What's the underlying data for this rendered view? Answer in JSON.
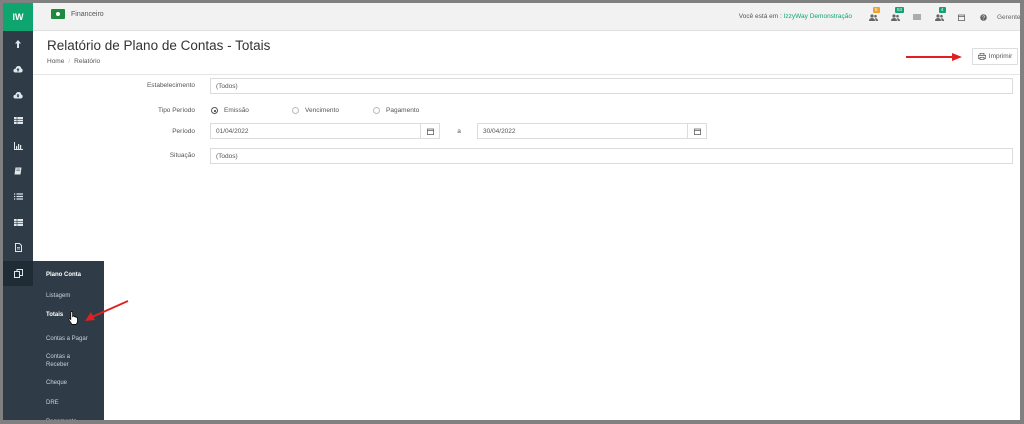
{
  "app": {
    "logo": "IW",
    "module": "Financeiro"
  },
  "topbar": {
    "prefix": "Você está em : ",
    "company": "IzzyWay Demonstração",
    "user": "Gerente",
    "badges": [
      {
        "icon": "users-icon",
        "count": "5",
        "color": "#f0a030"
      },
      {
        "icon": "users-icon",
        "count": "53",
        "color": "#0fa56f"
      },
      {
        "icon": "list-icon",
        "count": "",
        "color": ""
      },
      {
        "icon": "users-icon",
        "count": "4",
        "color": "#0fa56f"
      },
      {
        "icon": "calendar-icon",
        "count": "",
        "color": ""
      },
      {
        "icon": "help-icon",
        "count": "",
        "color": ""
      }
    ]
  },
  "page": {
    "title": "Relatório de Plano de Contas - Totais",
    "breadcrumb": {
      "home": "Home",
      "current": "Relatório"
    },
    "print_label": "Imprimir"
  },
  "form": {
    "estabelecimento": {
      "label": "Estabelecimento",
      "value": "(Todos)"
    },
    "tipo_periodo": {
      "label": "Tipo Período",
      "options": [
        "Emissão",
        "Vencimento",
        "Pagamento"
      ],
      "selected": "Emissão"
    },
    "periodo": {
      "label": "Período",
      "start": "01/04/2022",
      "separator": "a",
      "end": "30/04/2022"
    },
    "situacao": {
      "label": "Situação",
      "value": "(Todos)"
    }
  },
  "sidebar": {
    "icons": [
      "upload-icon",
      "cloud-upload-icon",
      "cloud-download-icon",
      "table-icon",
      "chart-icon",
      "book-icon",
      "list-icon",
      "table-icon",
      "document-icon",
      "copy-icon"
    ],
    "submenu": [
      {
        "label": "Plano Conta",
        "bold": true
      },
      {
        "label": "Listagem",
        "bold": false
      },
      {
        "label": "Totais",
        "bold": true
      },
      {
        "label": "Contas a Pagar",
        "bold": false
      },
      {
        "label": "Contas a Receber",
        "bold": false
      },
      {
        "label": "Cheque",
        "bold": false
      },
      {
        "label": "DRE",
        "bold": false
      },
      {
        "label": "Pagamento",
        "bold": false
      }
    ]
  },
  "colors": {
    "accent": "#0fa56f",
    "sidebar": "#2f3c48",
    "annotation": "#e02020"
  }
}
